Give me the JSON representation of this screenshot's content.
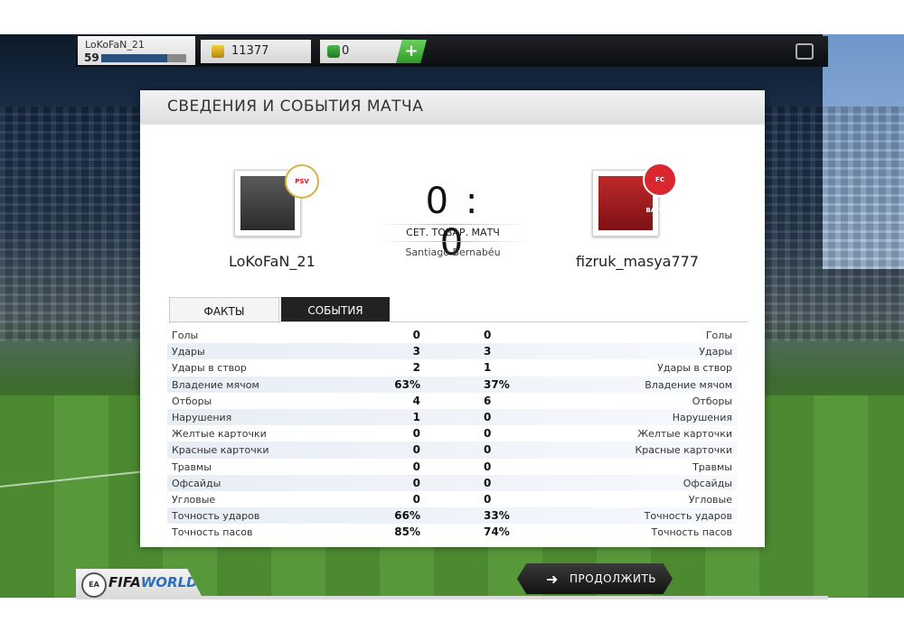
{
  "header": {
    "username": "LoKoFaN_21",
    "level": "59",
    "level_progress": 0.78,
    "coins": "11377",
    "points": "0",
    "add_label": "+"
  },
  "panel": {
    "title": "СВЕДЕНИЯ И СОБЫТИЯ МАТЧА",
    "home": {
      "name": "LoKoFaN_21",
      "badge": "PSV"
    },
    "away": {
      "name": "fizruk_masya777",
      "badge": "FC BAYERN"
    },
    "score": "0 : 0",
    "match_type": "СЕТ. ТОВАР. МАТЧ",
    "stadium": "Santiago Bernabéu",
    "tabs": [
      {
        "label": "ФАКТЫ"
      },
      {
        "label": "СОБЫТИЯ"
      }
    ],
    "stats": [
      {
        "label": "Голы",
        "home": "0",
        "away": "0"
      },
      {
        "label": "Удары",
        "home": "3",
        "away": "3"
      },
      {
        "label": "Удары в створ",
        "home": "2",
        "away": "1"
      },
      {
        "label": "Владение мячом",
        "home": "63%",
        "away": "37%"
      },
      {
        "label": "Отборы",
        "home": "4",
        "away": "6"
      },
      {
        "label": "Нарушения",
        "home": "1",
        "away": "0"
      },
      {
        "label": "Желтые карточки",
        "home": "0",
        "away": "0"
      },
      {
        "label": "Красные карточки",
        "home": "0",
        "away": "0"
      },
      {
        "label": "Травмы",
        "home": "0",
        "away": "0"
      },
      {
        "label": "Офсайды",
        "home": "0",
        "away": "0"
      },
      {
        "label": "Угловые",
        "home": "0",
        "away": "0"
      },
      {
        "label": "Точность ударов",
        "home": "66%",
        "away": "33%"
      },
      {
        "label": "Точность пасов",
        "home": "85%",
        "away": "74%"
      }
    ]
  },
  "footer": {
    "ea_label": "EA SPORTS",
    "logo_left": "FIFA",
    "logo_right": "WORLD",
    "continue_label": "ПРОДОЛЖИТЬ",
    "continue_icon": "arrow-right-icon"
  }
}
